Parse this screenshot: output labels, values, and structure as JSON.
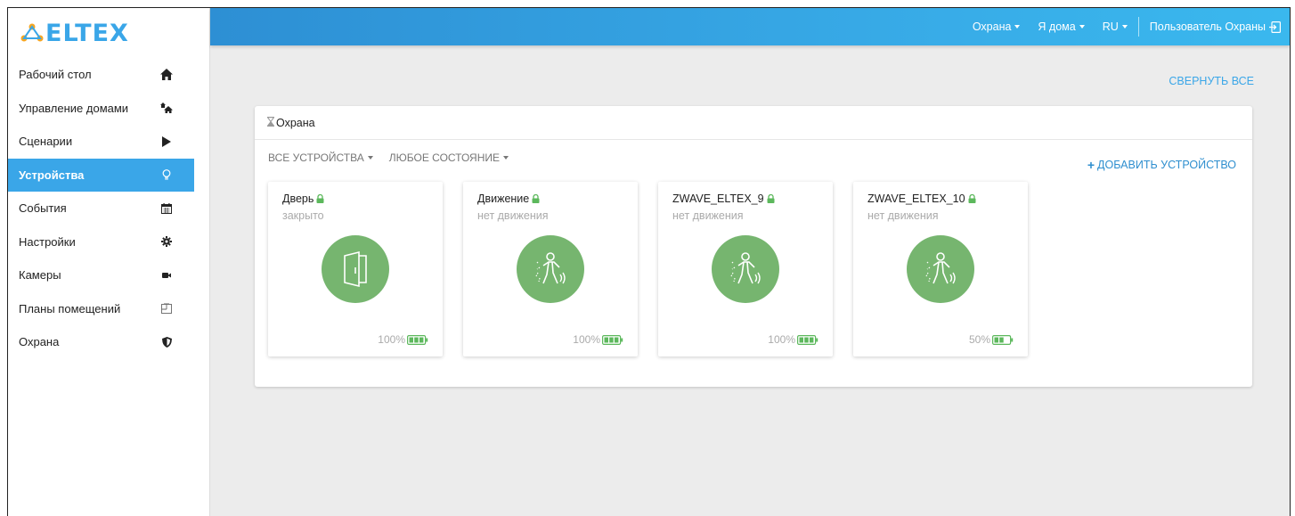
{
  "app": {
    "logo_text": "ELTEX"
  },
  "sidebar": {
    "items": [
      {
        "label": "Рабочий стол",
        "icon": "home-icon"
      },
      {
        "label": "Управление домами",
        "icon": "houses-icon"
      },
      {
        "label": "Сценарии",
        "icon": "play-icon"
      },
      {
        "label": "Устройства",
        "icon": "lightbulb-icon",
        "active": true
      },
      {
        "label": "События",
        "icon": "calendar-icon"
      },
      {
        "label": "Настройки",
        "icon": "gear-icon"
      },
      {
        "label": "Камеры",
        "icon": "video-camera-icon"
      },
      {
        "label": "Планы помещений",
        "icon": "floor-plan-icon"
      },
      {
        "label": "Охрана",
        "icon": "shield-icon"
      }
    ]
  },
  "topbar": {
    "security": "Охрана",
    "mode": "Я дома",
    "lang": "RU",
    "user": "Пользователь Охраны"
  },
  "main": {
    "collapse_all": "СВЕРНУТЬ ВСЕ",
    "panel": {
      "title": "Охрана",
      "filter_devices": "ВСЕ УСТРОЙСТВА",
      "filter_state": "ЛЮБОЕ СОСТОЯНИЕ",
      "add_device": "ДОБАВИТЬ УСТРОЙСТВО"
    },
    "devices": [
      {
        "name": "Дверь",
        "status": "закрыто",
        "battery": "100%",
        "battery_level": 1.0,
        "icon": "door-icon"
      },
      {
        "name": "Движение",
        "status": "нет движения",
        "battery": "100%",
        "battery_level": 1.0,
        "icon": "motion-icon"
      },
      {
        "name": "ZWAVE_ELTEX_9",
        "status": "нет движения",
        "battery": "100%",
        "battery_level": 1.0,
        "icon": "motion-icon"
      },
      {
        "name": "ZWAVE_ELTEX_10",
        "status": "нет движения",
        "battery": "50%",
        "battery_level": 0.5,
        "icon": "motion-icon"
      }
    ]
  },
  "colors": {
    "accent": "#3aa6e8",
    "device_ok": "#76b56f",
    "lock": "#5cb85c"
  }
}
